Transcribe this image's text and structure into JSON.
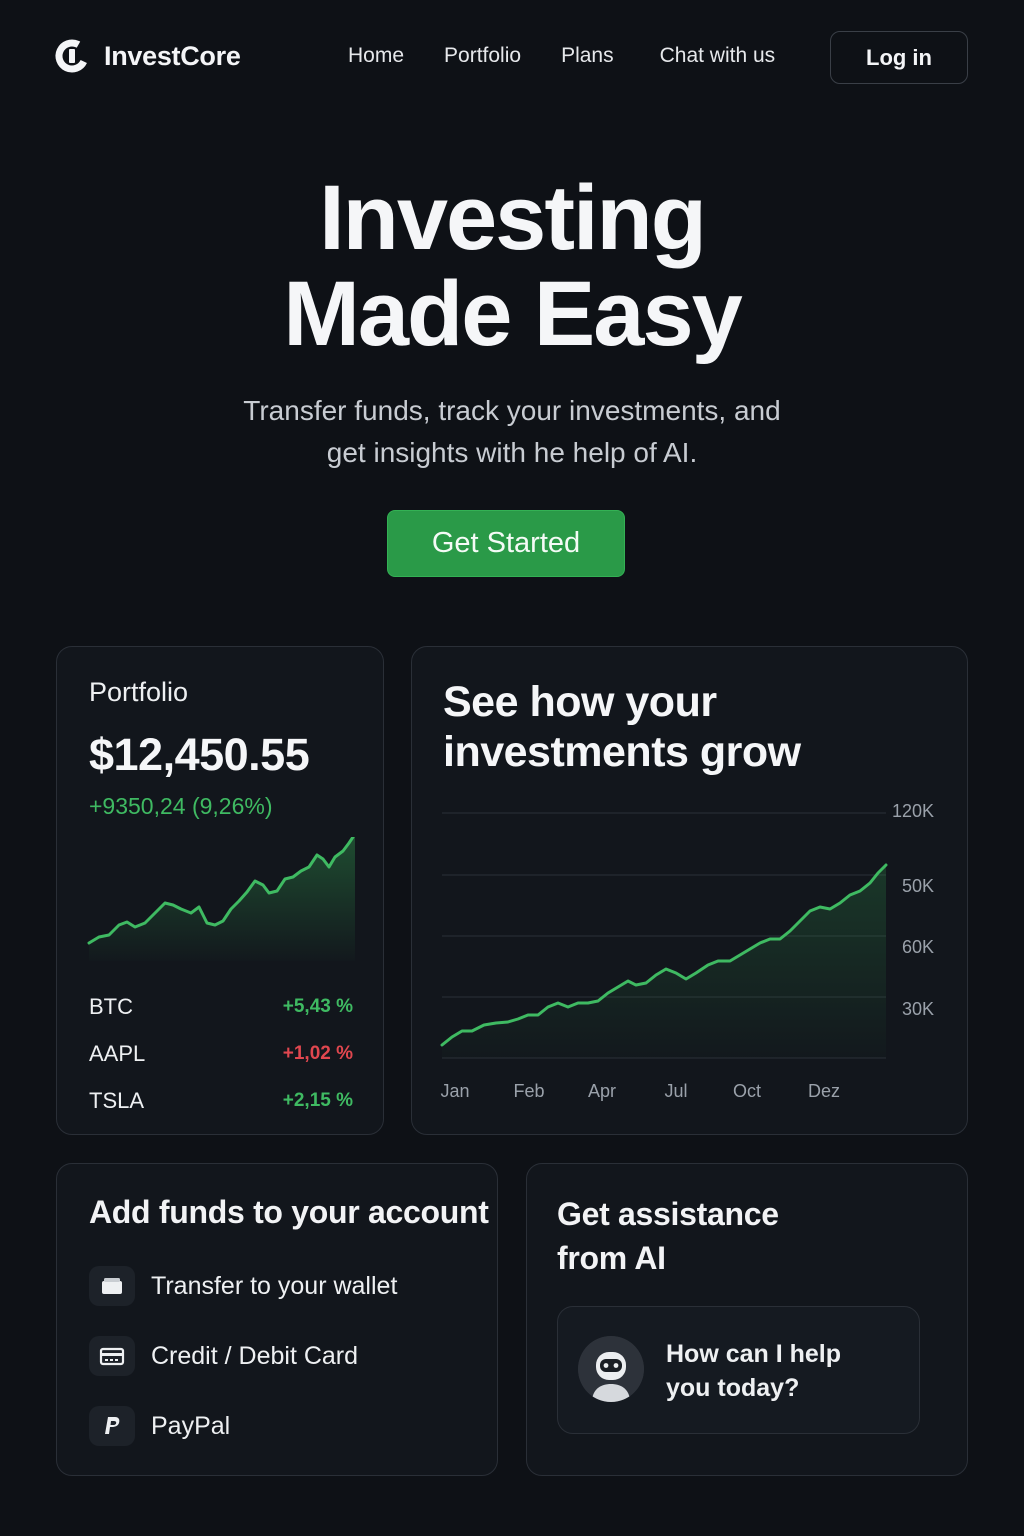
{
  "nav": {
    "brand": "InvestCore",
    "links": [
      "Home",
      "Portfolio",
      "Plans",
      "Chat with us"
    ],
    "login_label": "Log in"
  },
  "hero": {
    "title_line1": "Investing",
    "title_line2": "Made Easy",
    "subtitle_line1": "Transfer funds, track your investments, and",
    "subtitle_line2": "get insights with he help of AI.",
    "cta_label": "Get Started"
  },
  "portfolio": {
    "label": "Portfolio",
    "value": "$12,450.55",
    "change": "+9350,24 (9,26%)",
    "holdings": [
      {
        "symbol": "BTC",
        "change": "+5,43 %",
        "trend": "up"
      },
      {
        "symbol": "AAPL",
        "change": "+1,02 %",
        "trend": "down"
      },
      {
        "symbol": "TSLA",
        "change": "+2,15 %",
        "trend": "up"
      }
    ]
  },
  "growth": {
    "title_line1": "See how your",
    "title_line2": "investments grow",
    "y_ticks": [
      "120K",
      "50K",
      "60K",
      "30K"
    ],
    "x_ticks": [
      "Jan",
      "Feb",
      "Apr",
      "Jul",
      "Oct",
      "Dez"
    ]
  },
  "funds": {
    "title": "Add funds to your account",
    "options": [
      {
        "label": "Transfer to your wallet",
        "icon": "wallet-icon"
      },
      {
        "label": "Credit / Debit Card",
        "icon": "credit-card-icon"
      },
      {
        "label": "PayPal",
        "icon": "paypal-icon"
      }
    ]
  },
  "ai": {
    "title_line1": "Get assistance",
    "title_line2": "from AI",
    "message_line1": "How can I help",
    "message_line2": "you today?",
    "avatar_icon": "robot-avatar-icon"
  },
  "colors": {
    "background": "#0e1116",
    "card": "#12161c",
    "accent_green": "#2a9a48",
    "positive": "#3fba62",
    "negative": "#e0474f"
  }
}
